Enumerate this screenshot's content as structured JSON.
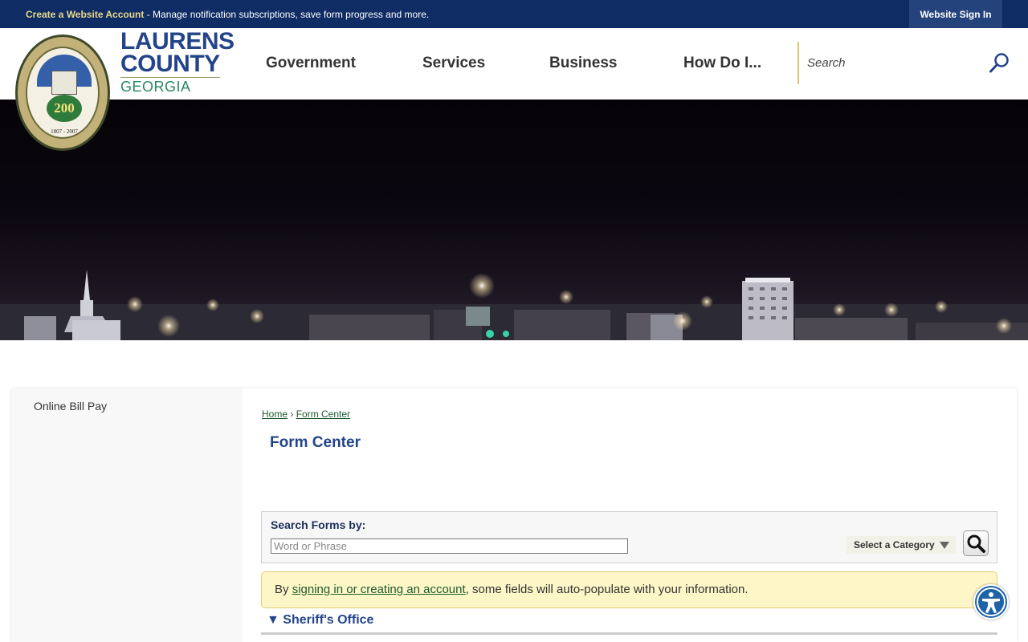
{
  "topbar": {
    "create_link": "Create a Website Account",
    "message": " - Manage notification subscriptions, save form progress and more.",
    "signin": "Website Sign In"
  },
  "brand": {
    "line1": "LAURENS",
    "line2": "COUNTY",
    "line3": "GEORGIA",
    "seal_number": "200",
    "seal_years": "1807 - 2007"
  },
  "nav": {
    "items": [
      "Government",
      "Services",
      "Business",
      "How Do I..."
    ]
  },
  "search": {
    "placeholder": "Search"
  },
  "sidebar": {
    "items": [
      "Online Bill Pay"
    ]
  },
  "breadcrumb": {
    "home": "Home",
    "separator": " › ",
    "current": "Form Center"
  },
  "page": {
    "title": "Form Center"
  },
  "form_search": {
    "label": "Search Forms by:",
    "placeholder": "Word or Phrase",
    "category": "Select a Category"
  },
  "notice": {
    "prefix": "By ",
    "link": "signing in or creating an account",
    "suffix": ", some fields will auto-populate with your information."
  },
  "sections": [
    {
      "title": "Sheriff's Office",
      "expanded": true
    }
  ],
  "colors": {
    "topbar": "#0f2c64",
    "brand_blue": "#24448a",
    "brand_green": "#27885f",
    "accent_gold": "#d8c66e",
    "notice_bg": "#fdf6c6"
  }
}
